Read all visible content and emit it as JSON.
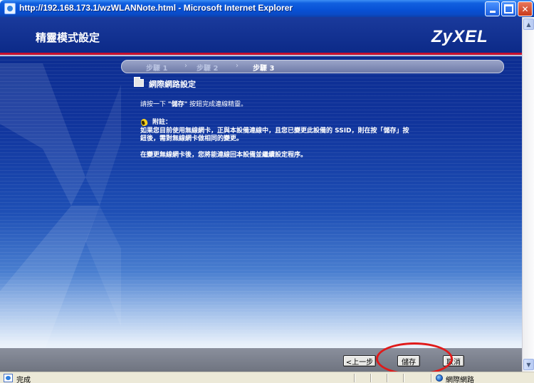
{
  "window": {
    "title": "http://192.168.173.1/wzWLANNote.html - Microsoft Internet Explorer",
    "icon": "ie-icon"
  },
  "header": {
    "title": "精靈模式設定",
    "logo": "ZyXEL"
  },
  "steps": [
    {
      "label": "步驟 1",
      "active": false
    },
    {
      "label": "步驟 2",
      "active": false
    },
    {
      "label": "步驟 3",
      "active": true
    }
  ],
  "section": {
    "title": "網際網路設定"
  },
  "content": {
    "instruction_prefix": "請按一下 ",
    "instruction_button": "\"儲存\"",
    "instruction_suffix": " 按鈕完成連線精靈。",
    "note_title": "附註：",
    "note_line1": "如果您目前使用無線網卡，正與本設備連線中，且您已變更此設備的 SSID，則在按「儲存」按",
    "note_line2": "鈕後，需對無線網卡做相同的變更。",
    "reconnect_text": "在變更無線網卡後，您將能連線回本設備並繼續設定程序。"
  },
  "buttons": {
    "prev": "<上一步",
    "save": "儲存",
    "cancel": "取消"
  },
  "statusbar": {
    "status": "完成",
    "zone": "網際網路"
  },
  "colors": {
    "header": "#0c2a88",
    "accent_red": "#c8102e",
    "highlight_oval": "#e01a1a"
  }
}
